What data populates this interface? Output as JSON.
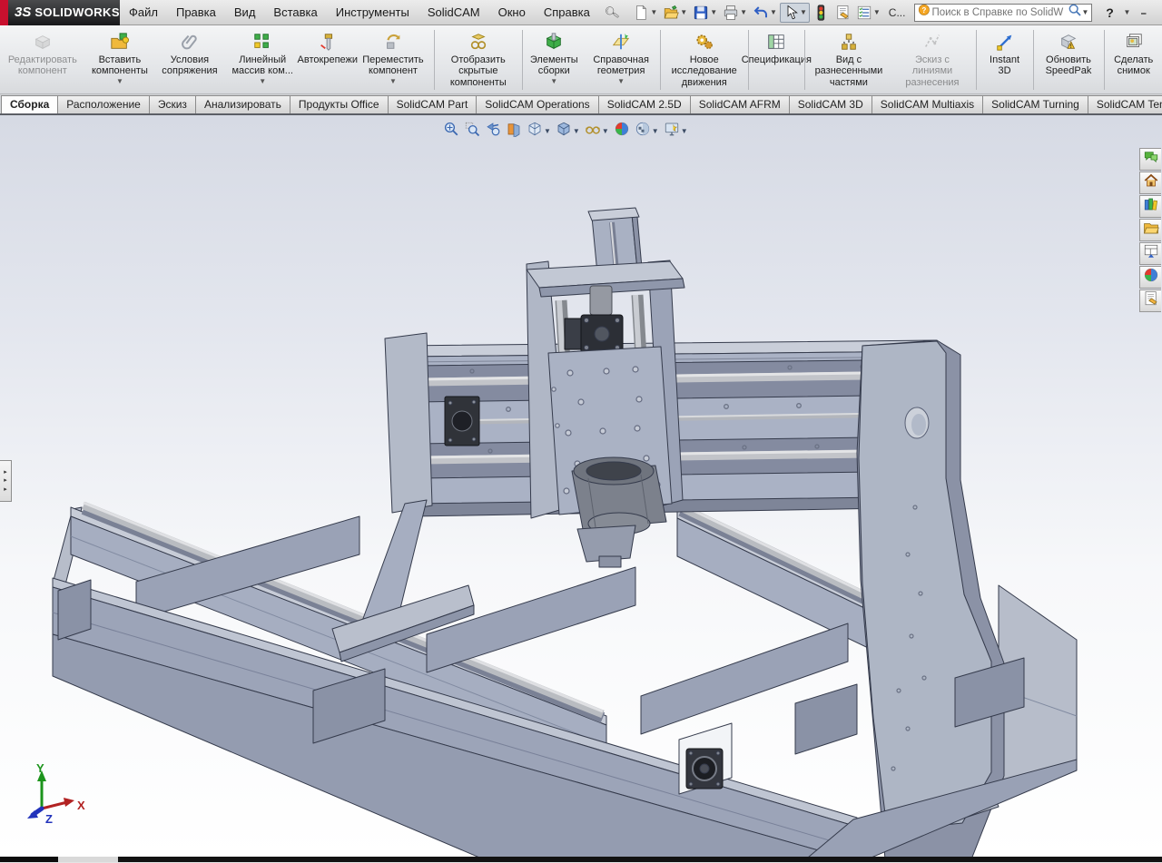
{
  "titlebar": {
    "logo_mark": "3S",
    "logo_text": "SOLIDWORKS",
    "menus": [
      "Файл",
      "Правка",
      "Вид",
      "Вставка",
      "Инструменты",
      "SolidCAM",
      "Окно",
      "Справка"
    ],
    "pin_icon": "collapse-menubar-pin",
    "quick_icons": [
      {
        "name": "new-document-icon",
        "dropdown": true
      },
      {
        "name": "open-icon",
        "dropdown": true
      },
      {
        "name": "save-icon",
        "dropdown": true
      },
      {
        "name": "print-icon",
        "dropdown": true
      },
      {
        "name": "undo-icon",
        "dropdown": true
      },
      {
        "name": "select-cursor-icon",
        "dropdown": true,
        "pressed": true
      },
      {
        "name": "rebuild-traffic-light-icon",
        "dropdown": false
      },
      {
        "name": "file-properties-icon",
        "dropdown": false
      },
      {
        "name": "options-icon",
        "dropdown": true
      }
    ],
    "truncated_item": "C...",
    "search": {
      "placeholder": "Поиск в Справке по SolidW",
      "balloon_icon": "help-balloon-icon",
      "magnifier_icon": "search-magnifier-icon"
    },
    "help_label": "?",
    "window_buttons": [
      "minimize-icon",
      "restore-icon",
      "cascade-windows-icon",
      "close-icon"
    ]
  },
  "ribbon": {
    "items": [
      {
        "icon": "edit-component",
        "label": "Редактировать компонент",
        "disabled": true
      },
      {
        "icon": "insert-components",
        "label": "Вставить компоненты",
        "dropdown": true
      },
      {
        "icon": "mates",
        "label": "Условия сопряжения"
      },
      {
        "icon": "linear-pattern",
        "label": "Линейный массив ком...",
        "dropdown": true
      },
      {
        "icon": "smart-fasteners",
        "label": "Автокрепежи"
      },
      {
        "icon": "move-component",
        "label": "Переместить компонент",
        "dropdown": true
      },
      "sep",
      {
        "icon": "show-hidden",
        "label": "Отобразить скрытые компоненты"
      },
      "sep",
      {
        "icon": "assembly-features",
        "label": "Элементы сборки",
        "dropdown": true
      },
      {
        "icon": "reference-geometry",
        "label": "Справочная геометрия",
        "dropdown": true
      },
      "sep",
      {
        "icon": "motion-study",
        "label": "Новое исследование движения"
      },
      "sep",
      {
        "icon": "bom",
        "label": "Спецификация"
      },
      "sep",
      {
        "icon": "exploded-view",
        "label": "Вид с разнесенными частями"
      },
      {
        "icon": "explode-sketch",
        "label": "Эскиз с линиями разнесения",
        "disabled": true
      },
      "sep",
      {
        "icon": "instant3d",
        "label": "Instant 3D"
      },
      "sep",
      {
        "icon": "speedpak",
        "label": "Обновить SpeedPak"
      },
      "sep",
      {
        "icon": "snapshot",
        "label": "Сделать снимок"
      }
    ]
  },
  "tabs": {
    "active": "Сборка",
    "items": [
      "Сборка",
      "Расположение",
      "Эскиз",
      "Анализировать",
      "Продукты Office",
      "SolidCAM Part",
      "SolidCAM Operations",
      "SolidCAM 2.5D",
      "SolidCAM AFRM",
      "SolidCAM 3D",
      "SolidCAM Multiaxis",
      "SolidCAM Turning",
      "SolidCAM Templates"
    ]
  },
  "headsup": {
    "icons": [
      {
        "name": "zoom-to-fit-icon",
        "dropdown": false
      },
      {
        "name": "zoom-to-area-icon",
        "dropdown": false
      },
      {
        "name": "previous-view-icon",
        "dropdown": false
      },
      {
        "name": "section-view-icon",
        "dropdown": false
      },
      {
        "name": "view-orientation-icon",
        "dropdown": true
      },
      {
        "name": "display-style-icon",
        "dropdown": true
      },
      {
        "name": "hide-show-items-icon",
        "dropdown": true
      },
      {
        "name": "apply-scene-icon",
        "dropdown": false
      },
      {
        "name": "view-settings-icon",
        "dropdown": true
      },
      {
        "name": "compare-screenshot-icon",
        "dropdown": true
      }
    ]
  },
  "taskpane": {
    "icons": [
      "forum-icon",
      "resources-home-icon",
      "design-library-icon",
      "file-explorer-icon",
      "view-palette-icon",
      "appearances-icon",
      "custom-properties-icon"
    ]
  },
  "tree_expander_arrows": "▸▸▸",
  "viewport": {
    "model_name": "cnc-router-assembly",
    "triad": {
      "x": "X",
      "y": "Y",
      "z": "Z"
    }
  },
  "colors": {
    "accent_red_stripe": "#c8102e",
    "model_face": "#a8b0c3",
    "model_top": "#c7ccd7",
    "model_dark_side": "#8b92a6",
    "hardware_dark": "#2c2f36",
    "viewport_top": "#d6dae4",
    "viewport_bottom": "#ffffff"
  }
}
